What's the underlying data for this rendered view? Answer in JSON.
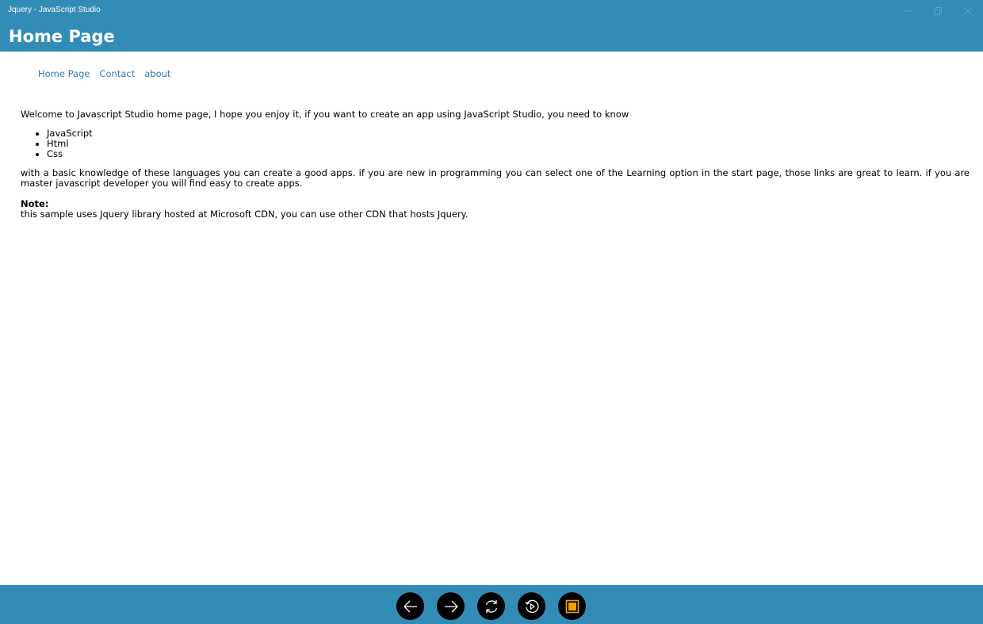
{
  "window": {
    "title": "Jquery - JavaScript Studio"
  },
  "header": {
    "title": "Home Page"
  },
  "nav": {
    "items": [
      {
        "label": "Home Page"
      },
      {
        "label": "Contact"
      },
      {
        "label": "about"
      }
    ]
  },
  "content": {
    "welcome": "Welcome to Javascript Studio home page, I hope you enjoy it, if you want to create an app using JavaScript Studio, you need to know",
    "languages": [
      "JavaScript",
      "Html",
      "Css"
    ],
    "basic": "with a basic knowledge of these languages you can create a good apps. if you are new in programming you can select one of the Learning option in the start page, those links are great to learn. if you are master javascript developer you will find easy to create apps.",
    "note_label": "Note:",
    "note_text": "this sample uses Jquery library hosted at Microsoft CDN, you can use other CDN that hosts Jquery."
  },
  "toolbar": {
    "buttons": [
      {
        "icon": "arrow-left-icon"
      },
      {
        "icon": "arrow-right-icon"
      },
      {
        "icon": "refresh-icon"
      },
      {
        "icon": "replay-icon"
      },
      {
        "icon": "stop-icon"
      }
    ]
  },
  "colors": {
    "accent": "#328cb6",
    "link": "#3479b5",
    "stop": "#f2a007"
  }
}
